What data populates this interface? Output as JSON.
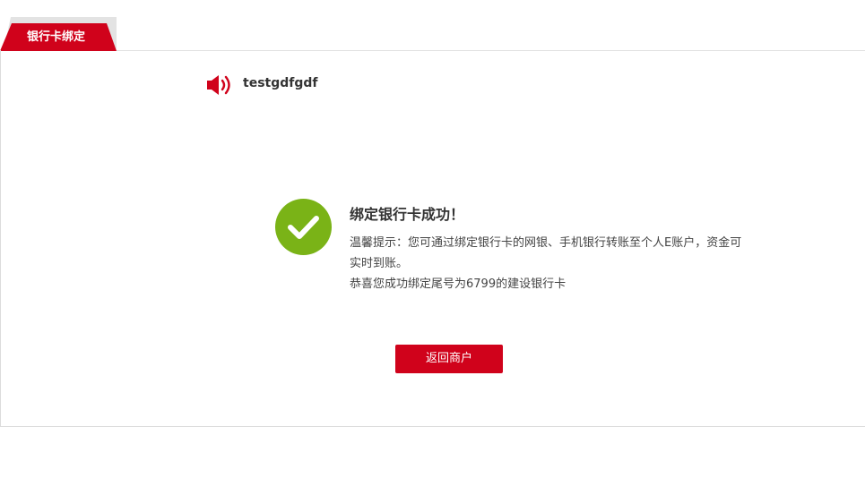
{
  "header": {
    "tab_label": "银行卡绑定"
  },
  "merchant": {
    "name": "testgdfgdf",
    "icon": "speaker-icon"
  },
  "result": {
    "icon": "check-circle-icon",
    "title": "绑定银行卡成功！",
    "tip": "温馨提示：您可通过绑定银行卡的网银、手机银行转账至个人E账户，资金可实时到账。",
    "detail": "恭喜您成功绑定尾号为6799的建设银行卡"
  },
  "actions": {
    "back_label": "返回商户"
  },
  "colors": {
    "brand_red": "#d0021b",
    "success_green": "#7ab317"
  }
}
